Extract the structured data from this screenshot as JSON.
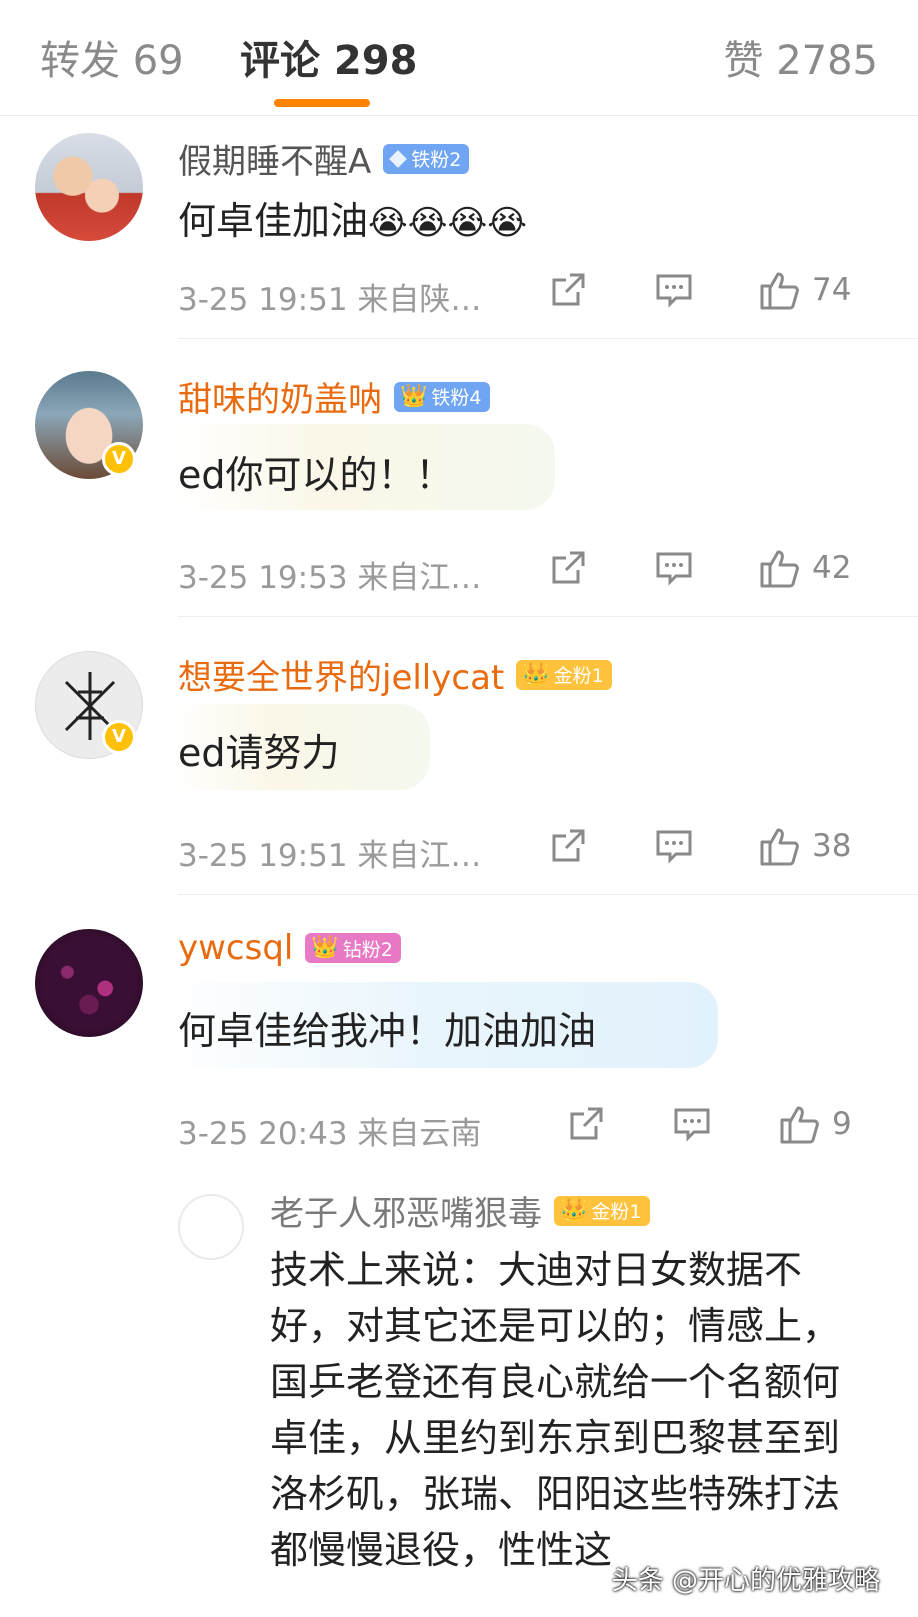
{
  "tabs": {
    "forward": "转发 69",
    "comments": "评论 298",
    "likes": "赞 2785"
  },
  "comments": [
    {
      "username": "假期睡不醒A",
      "badge": "铁粉2",
      "text": "何卓佳加油",
      "emojis": "😭😭😭😭",
      "time_location": "3-25 19:51 来自陕…",
      "likes": "74"
    },
    {
      "username": "甜味的奶盖呐",
      "badge": "铁粉4",
      "text": "ed你可以的！！",
      "time_location": "3-25 19:53 来自江…",
      "likes": "42"
    },
    {
      "username": "想要全世界的jellycat",
      "badge": "金粉1",
      "text": "ed请努力",
      "time_location": "3-25 19:51 来自江…",
      "likes": "38"
    },
    {
      "username": "ywcsql",
      "badge": "钻粉2",
      "text": "何卓佳给我冲！加油加油",
      "time_location": "3-25 20:43 来自云南",
      "likes": "9"
    }
  ],
  "reply": {
    "username": "老子人邪恶嘴狠毒",
    "badge": "金粉1",
    "text": "技术上来说：大迪对日女数据不好，对其它还是可以的；情感上，国乒老登还有良心就给一个名额何卓佳，从里约到东京到巴黎甚至到洛杉矶，张瑞、阳阳这些特殊打法都慢慢退役，性性这"
  },
  "watermark": "头条 @开心的优雅攻略",
  "colors": {
    "accent": "#ff8200",
    "gold_username": "#e86b10",
    "iron_badge": "#6fa5f2",
    "gold_badge": "#ffc23d",
    "diamond_badge": "#e879c4"
  }
}
